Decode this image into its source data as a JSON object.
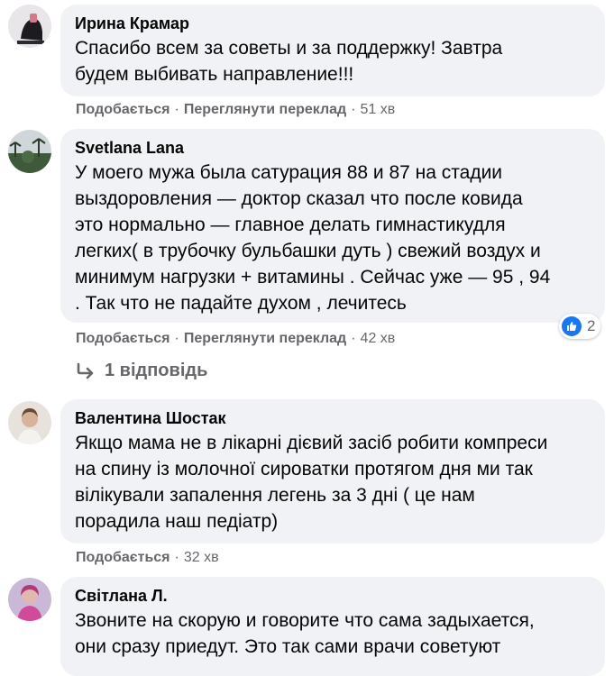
{
  "comments": [
    {
      "author": "Ирина Крамар",
      "text": "Спасибо всем за советы и за поддержку! Завтра\nбудем выбивать направление!!!",
      "like": "Подобається",
      "translate": "Переглянути переклад",
      "time": "51 хв"
    },
    {
      "author": "Svetlana Lana",
      "text": "У моего мужа была сатурация 88 и 87 на стадии\nвыздоровления — доктор сказал что после ковида\nэто нормально — главное делать гимнастикудля\nлегких( в трубочку бульбашки дуть ) свежий воздух и\nминимум нагрузки + витамины . Сейчас уже — 95 , 94\n. Так что не падайте духом , лечитесь",
      "like": "Подобається",
      "translate": "Переглянути переклад",
      "time": "42 хв",
      "reaction_count": "2",
      "replies_label": "1 відповідь"
    },
    {
      "author": "Валентина Шостак",
      "text": "Якщо мама не в лікарні дієвий засіб робити компреси\nна спину із молочної сироватки протягом дня ми так\nвілікували запалення легень за 3 дні ( це нам\nпорадила наш педіатр)",
      "like": "Подобається",
      "time": "32 хв"
    },
    {
      "author": "Світлана Л.",
      "text": "Звоните на скорую и говорите что сама задыхается,\nони сразу приедут. Это так сами врачи советуют"
    }
  ],
  "colors": {
    "bubble": "#f0f2f5",
    "secondary_text": "#65676b",
    "like_blue": "#1877f2"
  },
  "icons": [
    "like-icon",
    "reply-arrow-icon"
  ]
}
